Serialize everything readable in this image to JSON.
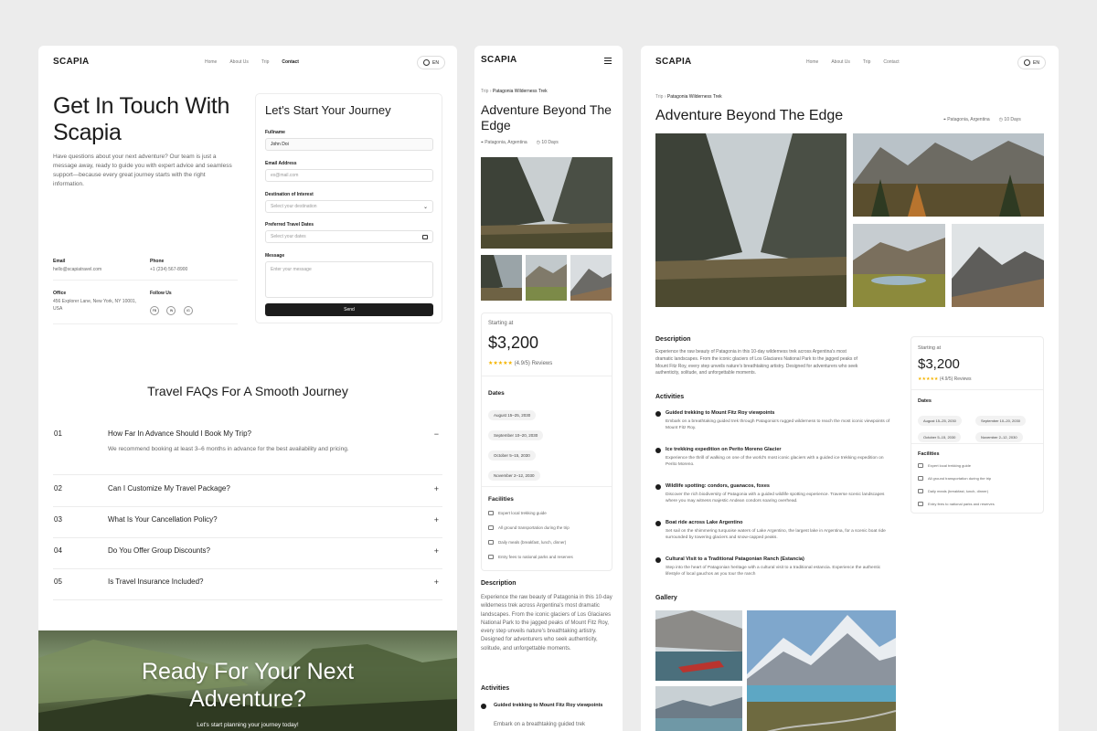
{
  "contact": {
    "logo": "SCAPIA",
    "nav": [
      "Home",
      "About Us",
      "Trip",
      "Contact"
    ],
    "lang": "EN",
    "heading_line1": "Get In Touch With",
    "heading_line2": "Scapia",
    "intro": "Have questions about your next adventure? Our team is just a message away, ready to guide you with expert advice and seamless support—because every great journey starts with the right information.",
    "email_label": "Email",
    "email_value": "hello@scapiatravel.com",
    "phone_label": "Phone",
    "phone_value": "+1 (234) 567-8900",
    "office_label": "Office",
    "office_value": "456 Explorer Lane, New York, NY 10001, USA",
    "follow_label": "Follow Us",
    "socials": [
      "FB",
      "IN",
      "IG"
    ],
    "form": {
      "title": "Let's Start Your Journey",
      "fullname_label": "Fullname",
      "fullname_value": "John Doi",
      "email_label": "Email Address",
      "email_placeholder": "ex@mail.com",
      "destination_label": "Destination of Interest",
      "destination_placeholder": "Select your destination",
      "dates_label": "Preferred Travel Dates",
      "dates_placeholder": "Select your dates",
      "message_label": "Message",
      "message_placeholder": "Enter your message",
      "send": "Send"
    },
    "faq_title": "Travel FAQs For A Smooth Journey",
    "faqs": [
      {
        "num": "01",
        "q": "How Far In Advance Should I Book My Trip?",
        "a": "We recommend booking at least 3–6 months in advance for the best availability and pricing.",
        "sign": "−"
      },
      {
        "num": "02",
        "q": "Can I Customize My Travel Package?",
        "sign": "+"
      },
      {
        "num": "03",
        "q": "What Is Your Cancellation Policy?",
        "sign": "+"
      },
      {
        "num": "04",
        "q": "Do You Offer Group Discounts?",
        "sign": "+"
      },
      {
        "num": "05",
        "q": "Is Travel Insurance Included?",
        "sign": "+"
      }
    ],
    "cta_line1": "Ready For Your Next",
    "cta_line2": "Adventure?",
    "cta_sub": "Let's start planning your journey today!"
  },
  "mobile": {
    "logo": "SCAPIA",
    "crumb_root": "Trip",
    "crumb_current": "Patagonia Wilderness Trek",
    "title": "Adventure Beyond The Edge",
    "location": "Patagonia, Argentina",
    "duration": "10 Days",
    "starting_label": "Starting at",
    "price": "$3,200",
    "rating": "(4.9/5) Reviews",
    "dates_label": "Dates",
    "dates": [
      "August 15–25, 2030",
      "September 10–20, 2030",
      "October 5–15, 2030",
      "November 2–12, 2030"
    ],
    "facilities_label": "Facilities",
    "facilities": [
      "Expert local trekking guide",
      "All ground transportation during the trip",
      "Daily meals (breakfast, lunch, dinner)",
      "Entry fees to national parks and reserves"
    ],
    "description_label": "Description",
    "description": "Experience the raw beauty of Patagonia in this 10-day wilderness trek across Argentina's most dramatic landscapes. From the iconic glaciers of Los Glaciares National Park to the jagged peaks of Mount Fitz Roy, every step unveils nature's breathtaking artistry. Designed for adventurers who seek authenticity, solitude, and unforgettable moments.",
    "activities_label": "Activities",
    "activity1_title": "Guided trekking to Mount Fitz Roy viewpoints",
    "activity1_desc": "Embark on a breathtaking guided trek"
  },
  "desktop": {
    "logo": "SCAPIA",
    "nav": [
      "Home",
      "About Us",
      "Trip",
      "Contact"
    ],
    "lang": "EN",
    "crumb_root": "Trip",
    "crumb_current": "Patagonia Wilderness Trek",
    "title": "Adventure Beyond The Edge",
    "location": "Patagonia, Argentina",
    "duration": "10 Days",
    "description_label": "Description",
    "description": "Experience the raw beauty of Patagonia in this 10-day wilderness trek across Argentina's most dramatic landscapes. From the iconic glaciers of Los Glaciares National Park to the jagged peaks of Mount Fitz Roy, every step unveils nature's breathtaking artistry. Designed for adventurers who seek authenticity, solitude, and unforgettable moments.",
    "activities_label": "Activities",
    "activities": [
      {
        "title": "Guided trekking to Mount Fitz Roy viewpoints",
        "desc": "Embark on a breathtaking guided trek through Patagonia's rugged wilderness to reach the most iconic viewpoints of Mount Fitz Roy."
      },
      {
        "title": "Ice trekking expedition on Perito Moreno Glacier",
        "desc": "Experience the thrill of walking on one of the world's most iconic glaciers with a guided ice trekking expedition on Perito Moreno."
      },
      {
        "title": "Wildlife spotting: condors, guanacos, foxes",
        "desc": "Discover the rich biodiversity of Patagonia with a guided wildlife spotting experience. Traverse scenic landscapes where you may witness majestic Andean condors soaring overhead."
      },
      {
        "title": "Boat ride across Lake Argentino",
        "desc": "Set sail on the shimmering turquoise waters of Lake Argentino, the largest lake in Argentina, for a scenic boat ride surrounded by towering glaciers and snow-capped peaks."
      },
      {
        "title": "Cultural Visit to a Traditional Patagonian Ranch (Estancia)",
        "desc": "Step into the heart of Patagonian heritage with a cultural visit to a traditional estancia. Experience the authentic lifestyle of local gauchos as you tour the ranch"
      }
    ],
    "gallery_label": "Gallery",
    "starting_label": "Starting at",
    "price": "$3,200",
    "rating": "(4.9/5) Reviews",
    "dates_label": "Dates",
    "dates": [
      "August 15–25, 2030",
      "September 10–20, 2030",
      "October 5–15, 2030",
      "November 2–12, 2030"
    ],
    "facilities_label": "Facilities",
    "facilities": [
      "Expert local trekking guide",
      "All ground transportation during the trip",
      "Daily meals (breakfast, lunch, dinner)",
      "Entry fees to national parks and reserves"
    ]
  },
  "colors": {
    "accent": "#1c1c1c",
    "star": "#f5b400",
    "background": "#ececec"
  }
}
